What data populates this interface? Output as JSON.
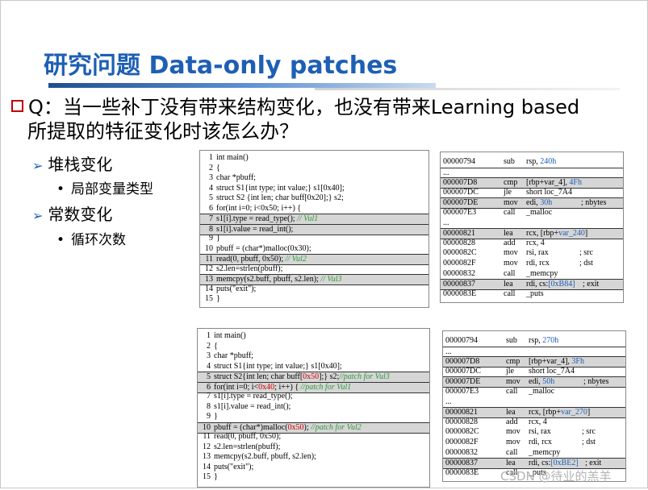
{
  "slide": {
    "title": "研究问题 Data-only patches",
    "question_line1": "Q：当一些补丁没有带来结构变化，也没有带来Learning based",
    "question_line2": "所提取的特征变化时该怎么办？",
    "bullets": [
      {
        "label": "堆栈变化",
        "sub": "局部变量类型"
      },
      {
        "label": "常数变化",
        "sub": "循环次数"
      }
    ]
  },
  "top_code": [
    {
      "n": "1",
      "t": "int main()",
      "hl": false
    },
    {
      "n": "2",
      "t": "{",
      "hl": false
    },
    {
      "n": "3",
      "t": "      char *pbuff;",
      "hl": false
    },
    {
      "n": "4",
      "t": "      struct S1{int type; int value;} s1[0x40];",
      "hl": false
    },
    {
      "n": "5",
      "t": "      struct S2 {int len; char buff[0x20];} s2;",
      "hl": false
    },
    {
      "n": "6",
      "t": "      for(int i=0; i<0x50; i++) {",
      "hl": false
    },
    {
      "n": "7",
      "t": "         s1[i].type = read_type();",
      "c": " // Vul1",
      "hl": true
    },
    {
      "n": "8",
      "t": "         s1[i].value = read_int();",
      "hl": true
    },
    {
      "n": "9",
      "t": "      }",
      "hl": false
    },
    {
      "n": "10",
      "t": "      pbuff = (char*)malloc(0x30);",
      "hl": false
    },
    {
      "n": "11",
      "t": "      read(0, pbuff, 0x50);",
      "c": " // Vul2",
      "hl": true
    },
    {
      "n": "12",
      "t": "      s2.len=strlen(pbuff);",
      "hl": false
    },
    {
      "n": "13",
      "t": "      memcpy(s2.buff, pbuff, s2.len);",
      "c": " // Vul3",
      "hl": true
    },
    {
      "n": "14",
      "t": "      puts(\"exit\");",
      "hl": false
    },
    {
      "n": "15",
      "t": "}",
      "hl": false
    }
  ],
  "bottom_code": [
    {
      "n": "1",
      "t": "int main()",
      "hl": false
    },
    {
      "n": "2",
      "t": "{",
      "hl": false
    },
    {
      "n": "3",
      "t": "      char *pbuff;",
      "hl": false
    },
    {
      "n": "4",
      "t": "      struct S1{int type; int value;} s1[0x40];",
      "hl": false
    },
    {
      "n": "5",
      "pre": "      struct S2{int len; char buff[",
      "red": "0x50",
      "post": "];} s2;",
      "c": "//patch for Vul3",
      "hl": true
    },
    {
      "n": "6",
      "pre": "      for(int i=0; i<",
      "red": "0x40",
      "post": "; i++) { ",
      "c": "//patch for Vul1",
      "hl": true
    },
    {
      "n": "7",
      "t": "         s1[i].type = read_type();",
      "hl": false
    },
    {
      "n": "8",
      "t": "         s1[i].value = read_int();",
      "hl": false
    },
    {
      "n": "9",
      "t": "      }",
      "hl": false
    },
    {
      "n": "10",
      "pre": "      pbuff = (char*)malloc(",
      "red": "0x50",
      "post": ");",
      "c": "    //patch for Vul2",
      "hl": true
    },
    {
      "n": "11",
      "t": "      read(0, pbuff,  0x50);",
      "hl": false
    },
    {
      "n": "12",
      "t": "      s2.len=strlen(pbuff);",
      "hl": false
    },
    {
      "n": "13",
      "t": "      memcpy(s2.buff, pbuff, s2.len);",
      "hl": false
    },
    {
      "n": "14",
      "t": "      puts(\"exit\");",
      "hl": false
    },
    {
      "n": "15",
      "t": "}",
      "hl": false
    }
  ],
  "top_asm": [
    {
      "addr": "00000794",
      "op": "sub",
      "arg": "rsp, ",
      "col": "240h",
      "cmt": "",
      "hl": false,
      "box": false
    },
    {
      "addr": "...",
      "op": "",
      "arg": "",
      "col": "",
      "cmt": "",
      "hl": false,
      "box": true
    },
    {
      "addr": "000007D8",
      "op": "cmp",
      "arg": "[rbp+var_4], ",
      "col": "4Fh",
      "cmt": "",
      "hl": true,
      "box": false
    },
    {
      "addr": "000007DC",
      "op": "jle",
      "arg": "short loc_7A4",
      "col": "",
      "cmt": "",
      "hl": false,
      "box": false
    },
    {
      "addr": "000007DE",
      "op": "mov",
      "arg": "edi, ",
      "col": "30h",
      "cmt": "; nbytes",
      "hl": true,
      "box": false
    },
    {
      "addr": "000007E3",
      "op": "call",
      "arg": "_malloc",
      "col": "",
      "cmt": "",
      "hl": false,
      "box": false
    },
    {
      "addr": "...",
      "op": "",
      "arg": "",
      "col": "",
      "cmt": "",
      "hl": false,
      "box": false
    },
    {
      "addr": "00000821",
      "op": "lea",
      "arg": "rcx, [rbp+",
      "col": "var_240",
      "post": "]",
      "cmt": "",
      "hl": true,
      "box": false
    },
    {
      "addr": "00000828",
      "op": "add",
      "arg": "rcx, 4",
      "col": "",
      "cmt": "",
      "hl": false,
      "box": false
    },
    {
      "addr": "0000082C",
      "op": "mov",
      "arg": "rsi, rax",
      "col": "",
      "cmt": "; src",
      "hl": false,
      "box": false
    },
    {
      "addr": "0000082F",
      "op": "mov",
      "arg": "rdi, rcx",
      "col": "",
      "cmt": "; dst",
      "hl": false,
      "box": false
    },
    {
      "addr": "00000832",
      "op": "call",
      "arg": "_memcpy",
      "col": "",
      "cmt": "",
      "hl": false,
      "box": false
    },
    {
      "addr": "00000837",
      "op": "lea",
      "arg": "rdi, cs:",
      "col": "[0xB84]",
      "cmt": "; exit",
      "hl": true,
      "box": false
    },
    {
      "addr": "0000083E",
      "op": "call",
      "arg": "_puts",
      "col": "",
      "cmt": "",
      "hl": false,
      "box": false
    }
  ],
  "bottom_asm": [
    {
      "addr": "00000794",
      "op": "sub",
      "arg": "rsp, ",
      "col": "270h",
      "cmt": "",
      "hl": false,
      "box": false
    },
    {
      "addr": "...",
      "op": "",
      "arg": "",
      "col": "",
      "cmt": "",
      "hl": false,
      "box": true
    },
    {
      "addr": "000007D8",
      "op": "cmp",
      "arg": "[rbp+var_4], ",
      "col": "3Fh",
      "cmt": "",
      "hl": true,
      "box": false
    },
    {
      "addr": "000007DC",
      "op": "jle",
      "arg": "short loc_7A4",
      "col": "",
      "cmt": "",
      "hl": false,
      "box": false
    },
    {
      "addr": "000007DE",
      "op": "mov",
      "arg": "edi, ",
      "col": "50h",
      "cmt": "; nbytes",
      "hl": true,
      "box": false
    },
    {
      "addr": "000007E3",
      "op": "call",
      "arg": "_malloc",
      "col": "",
      "cmt": "",
      "hl": false,
      "box": false
    },
    {
      "addr": "...",
      "op": "",
      "arg": "",
      "col": "",
      "cmt": "",
      "hl": false,
      "box": false
    },
    {
      "addr": "00000821",
      "op": "lea",
      "arg": "rcx, [rbp+",
      "col": "var_270",
      "post": "]",
      "cmt": "",
      "hl": true,
      "box": false
    },
    {
      "addr": "00000828",
      "op": "add",
      "arg": "rcx, 4",
      "col": "",
      "cmt": "",
      "hl": false,
      "box": false
    },
    {
      "addr": "0000082C",
      "op": "mov",
      "arg": "rsi, rax",
      "col": "",
      "cmt": "; src",
      "hl": false,
      "box": false
    },
    {
      "addr": "0000082F",
      "op": "mov",
      "arg": "rdi, rcx",
      "col": "",
      "cmt": "; dst",
      "hl": false,
      "box": false
    },
    {
      "addr": "00000832",
      "op": "call",
      "arg": "_memcpy",
      "col": "",
      "cmt": "",
      "hl": false,
      "box": false
    },
    {
      "addr": "00000837",
      "op": "lea",
      "arg": "rdi, cs:",
      "col": "[0xBE2]",
      "cmt": "; exit",
      "hl": true,
      "box": false
    },
    {
      "addr": "0000083E",
      "op": "call",
      "arg": "_puts",
      "col": "",
      "cmt": "",
      "hl": false,
      "box": false
    }
  ],
  "watermark": "CSDN @待业的羔羊"
}
